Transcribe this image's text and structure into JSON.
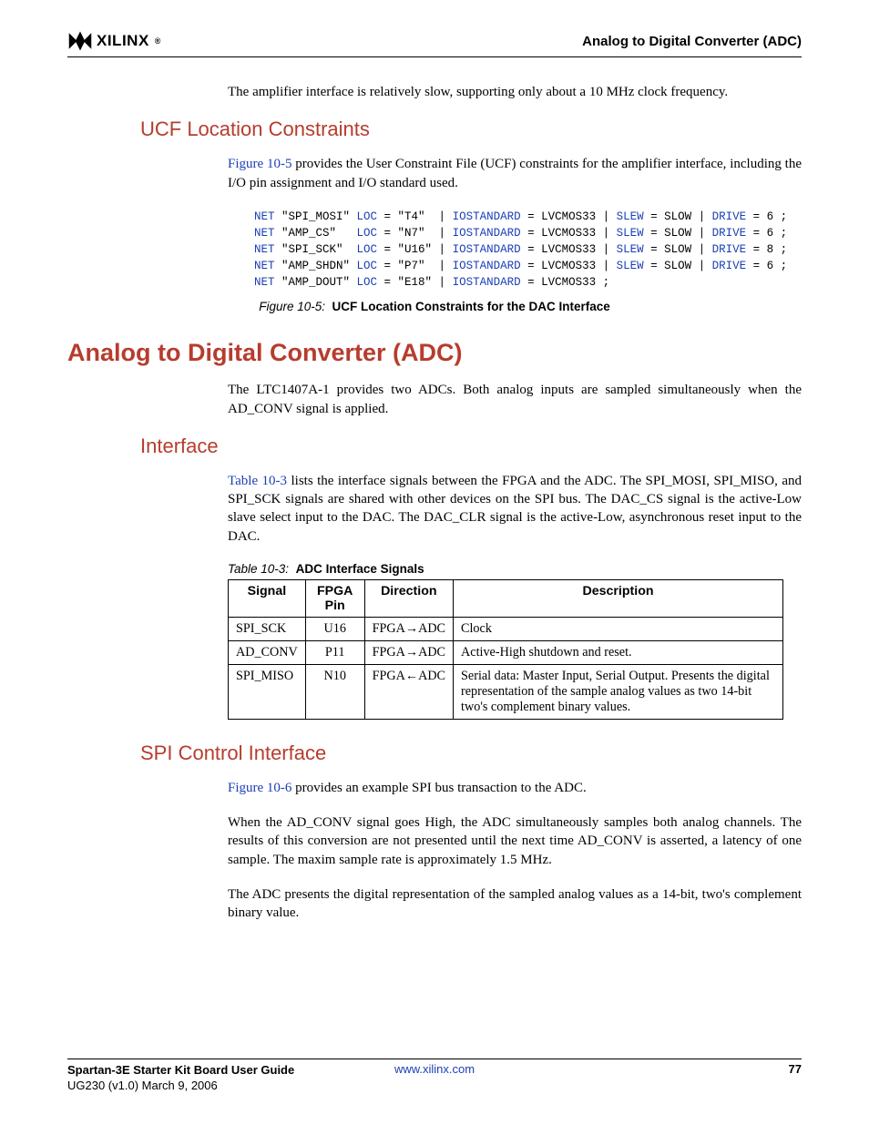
{
  "header": {
    "brand": "XILINX",
    "title": "Analog to Digital Converter (ADC)"
  },
  "intro_para": "The amplifier interface is relatively slow, supporting only about a 10 MHz clock frequency.",
  "ucf": {
    "heading": "UCF Location Constraints",
    "ref": "Figure 10-5",
    "para_rest": " provides the User Constraint File (UCF) constraints for the amplifier interface, including the I/O pin assignment and I/O standard used."
  },
  "code": {
    "lines": [
      {
        "kw1": "NET",
        "arg": " \"SPI_MOSI\" ",
        "kw2": "LOC",
        "eq": " = \"T4\"  | ",
        "kw3": "IOSTANDARD",
        "v1": " = LVCMOS33 | ",
        "kw4": "SLEW",
        "v2": " = SLOW | ",
        "kw5": "DRIVE",
        "v3": " = 6 ;"
      },
      {
        "kw1": "NET",
        "arg": " \"AMP_CS\"   ",
        "kw2": "LOC",
        "eq": " = \"N7\"  | ",
        "kw3": "IOSTANDARD",
        "v1": " = LVCMOS33 | ",
        "kw4": "SLEW",
        "v2": " = SLOW | ",
        "kw5": "DRIVE",
        "v3": " = 6 ;"
      },
      {
        "kw1": "NET",
        "arg": " \"SPI_SCK\"  ",
        "kw2": "LOC",
        "eq": " = \"U16\" | ",
        "kw3": "IOSTANDARD",
        "v1": " = LVCMOS33 | ",
        "kw4": "SLEW",
        "v2": " = SLOW | ",
        "kw5": "DRIVE",
        "v3": " = 8 ;"
      },
      {
        "kw1": "NET",
        "arg": " \"AMP_SHDN\" ",
        "kw2": "LOC",
        "eq": " = \"P7\"  | ",
        "kw3": "IOSTANDARD",
        "v1": " = LVCMOS33 | ",
        "kw4": "SLEW",
        "v2": " = SLOW | ",
        "kw5": "DRIVE",
        "v3": " = 6 ;"
      },
      {
        "kw1": "NET",
        "arg": " \"AMP_DOUT\" ",
        "kw2": "LOC",
        "eq": " = \"E18\" | ",
        "kw3": "IOSTANDARD",
        "v1": " = LVCMOS33 ;",
        "kw4": "",
        "v2": "",
        "kw5": "",
        "v3": ""
      }
    ],
    "caption_fig": "Figure 10-5:",
    "caption_text": "UCF Location Constraints for the DAC Interface"
  },
  "adc": {
    "heading": "Analog to Digital Converter (ADC)",
    "para": "The LTC1407A-1 provides two ADCs. Both analog inputs are sampled simultaneously when the AD_CONV signal is applied."
  },
  "iface": {
    "heading": "Interface",
    "ref": "Table 10-3",
    "para_rest": " lists the interface signals between the FPGA and the ADC. The SPI_MOSI, SPI_MISO, and SPI_SCK signals are shared with other devices on the SPI bus. The DAC_CS signal is the active-Low slave select input to the DAC. The DAC_CLR signal is the active-Low, asynchronous reset input to the DAC."
  },
  "table": {
    "caption_num": "Table 10-3:",
    "caption_text": "ADC Interface Signals",
    "headers": [
      "Signal",
      "FPGA Pin",
      "Direction",
      "Description"
    ],
    "rows": [
      {
        "sig": "SPI_SCK",
        "pin": "U16",
        "dir": "FPGA→ADC",
        "desc": "Clock"
      },
      {
        "sig": "AD_CONV",
        "pin": "P11",
        "dir": "FPGA→ADC",
        "desc": "Active-High shutdown and reset."
      },
      {
        "sig": "SPI_MISO",
        "pin": "N10",
        "dir": "FPGA←ADC",
        "desc": "Serial data: Master Input, Serial Output. Presents the digital representation of the sample analog values as two 14-bit two's complement binary values."
      }
    ]
  },
  "spi": {
    "heading": "SPI Control Interface",
    "ref": "Figure 10-6",
    "p1_rest": " provides an example SPI bus transaction to the ADC.",
    "p2": "When the AD_CONV signal goes High, the ADC simultaneously samples both analog channels. The results of this conversion are not presented until the next time AD_CONV is asserted, a latency of one sample. The maxim sample rate is approximately 1.5 MHz.",
    "p3": "The ADC presents the digital representation of the sampled analog values as a 14-bit, two's complement binary value."
  },
  "footer": {
    "doc_title": "Spartan-3E Starter Kit Board User Guide",
    "doc_id": "UG230 (v1.0) March 9, 2006",
    "url": "www.xilinx.com",
    "page": "77"
  }
}
